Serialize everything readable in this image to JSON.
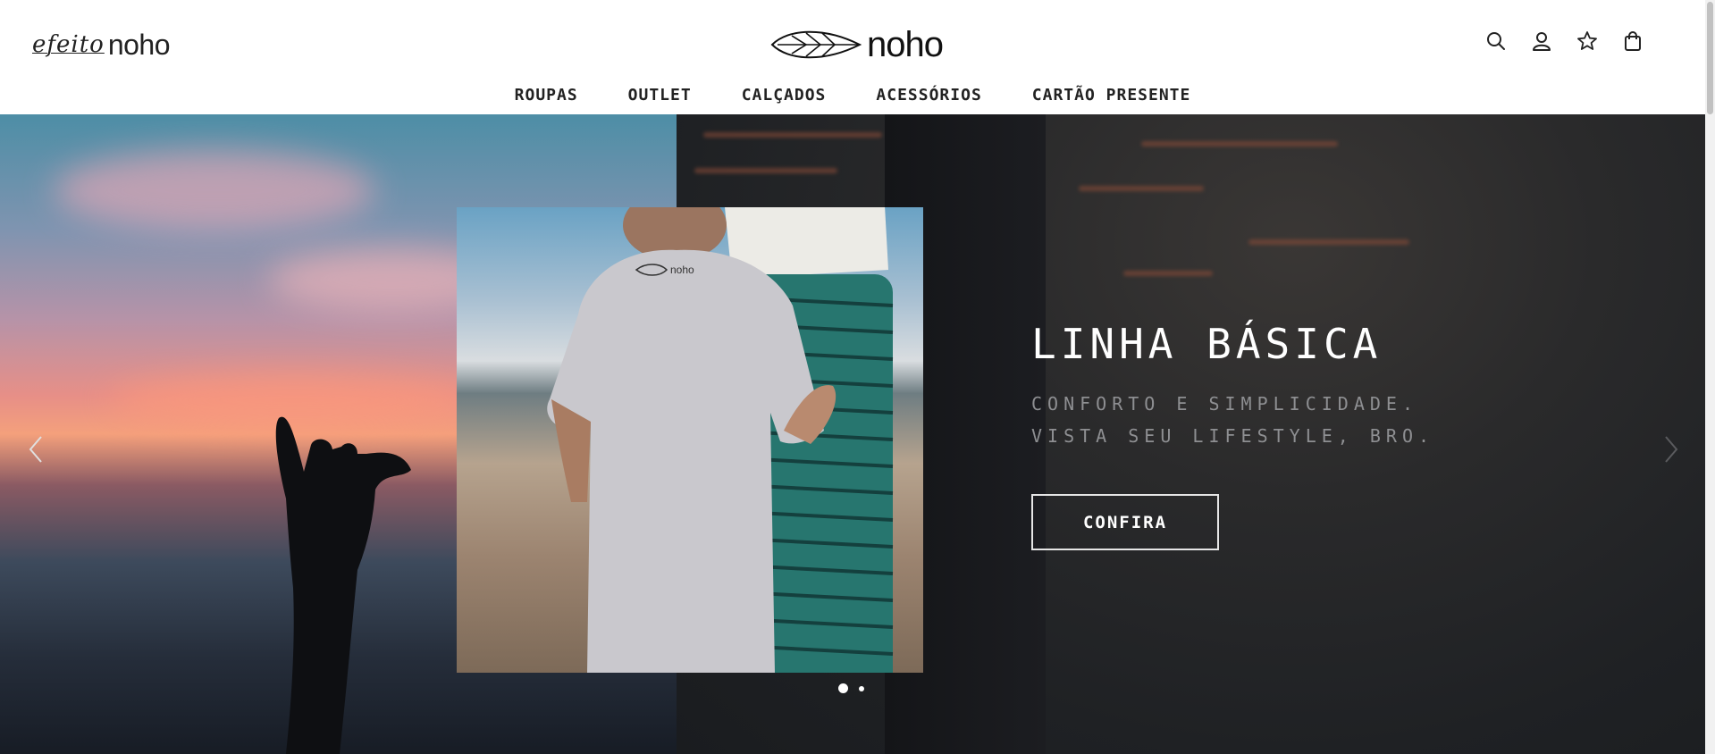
{
  "header": {
    "logo_left_script": "efeito",
    "logo_left_word": "noho",
    "logo_center_word": "noho",
    "icons": [
      "search-icon",
      "user-icon",
      "star-icon",
      "bag-icon"
    ]
  },
  "nav": {
    "items": [
      {
        "label": "ROUPAS"
      },
      {
        "label": "OUTLET"
      },
      {
        "label": "CALÇADOS"
      },
      {
        "label": "ACESSÓRIOS"
      },
      {
        "label": "CARTÃO PRESENTE"
      }
    ]
  },
  "hero": {
    "title": "LINHA BÁSICA",
    "subtitle_line1": "CONFORTO E SIMPLICIDADE.",
    "subtitle_line2": "VISTA SEU LIFESTYLE, BRO.",
    "button_label": "CONFIRA",
    "slides_total": 2,
    "active_slide": 1
  },
  "colors": {
    "text": "#1a1a1a",
    "hero_bg": "#1b1d20",
    "hero_title": "#ffffff",
    "hero_sub": "#8e8f92"
  }
}
